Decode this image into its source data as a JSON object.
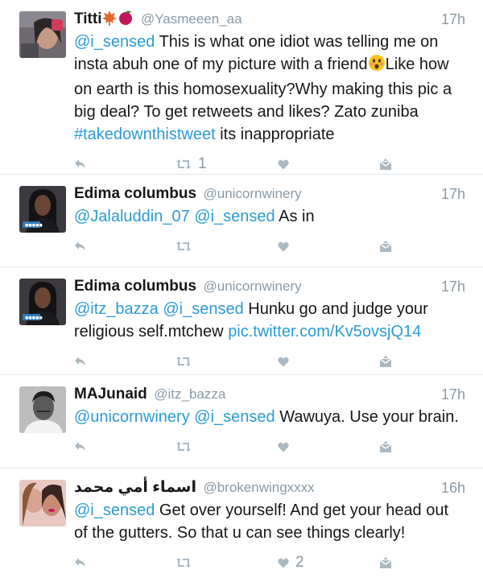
{
  "tweets": [
    {
      "name": "Titti",
      "handle": "@Yasmeeen_aa",
      "time": "17h",
      "parts": [
        {
          "t": "@i_sensed",
          "link": true
        },
        {
          "t": " This is what one idiot was telling me on insta abuh one of my picture with a friend"
        },
        {
          "emoji": "astonished-face-emoji"
        },
        {
          "t": "Like how on earth is this homosexuality?Why making this pic a big deal? To get retweets and likes? Zato zuniba "
        },
        {
          "t": "#takedownthistweet",
          "link": true
        },
        {
          "t": " its inappropriate"
        }
      ],
      "retweets": "1",
      "likes": "",
      "avatar": "selfie-photo",
      "name_emojis": [
        "maple-leaf-emoji",
        "peach-emoji"
      ]
    },
    {
      "name": "Edima columbus",
      "handle": "@unicornwinery",
      "time": "17h",
      "parts": [
        {
          "t": "@Jalaluddin_07",
          "link": true
        },
        {
          "t": " "
        },
        {
          "t": "@i_sensed",
          "link": true
        },
        {
          "t": " As in"
        }
      ],
      "retweets": "",
      "likes": "",
      "avatar": "woman-portrait-photo"
    },
    {
      "name": "Edima columbus",
      "handle": "@unicornwinery",
      "time": "17h",
      "parts": [
        {
          "t": "@itz_bazza",
          "link": true
        },
        {
          "t": " "
        },
        {
          "t": "@i_sensed",
          "link": true
        },
        {
          "t": " Hunku go and judge your religious self.mtchew "
        },
        {
          "t": "pic.twitter.com/Kv5ovsjQ14",
          "link": true
        }
      ],
      "retweets": "",
      "likes": "",
      "avatar": "woman-portrait-photo"
    },
    {
      "name": "MAJunaid",
      "handle": "@itz_bazza",
      "time": "17h",
      "parts": [
        {
          "t": "@unicornwinery",
          "link": true
        },
        {
          "t": " "
        },
        {
          "t": "@i_sensed",
          "link": true
        },
        {
          "t": " Wawuya. Use your brain."
        }
      ],
      "retweets": "",
      "likes": "",
      "avatar": "black-white-portrait-photo"
    },
    {
      "name": "اسماء أمي محمد",
      "handle": "@brokenwingxxxx",
      "time": "16h",
      "parts": [
        {
          "t": "@i_sensed",
          "link": true
        },
        {
          "t": " Get over yourself! And get your head out of the gutters. So that u can see things clearly!"
        }
      ],
      "retweets": "",
      "likes": "2",
      "avatar": "two-women-photo"
    }
  ],
  "colors": {
    "link": "#2b9bd6",
    "muted": "#8899a6",
    "divider": "#e1e8ed"
  }
}
